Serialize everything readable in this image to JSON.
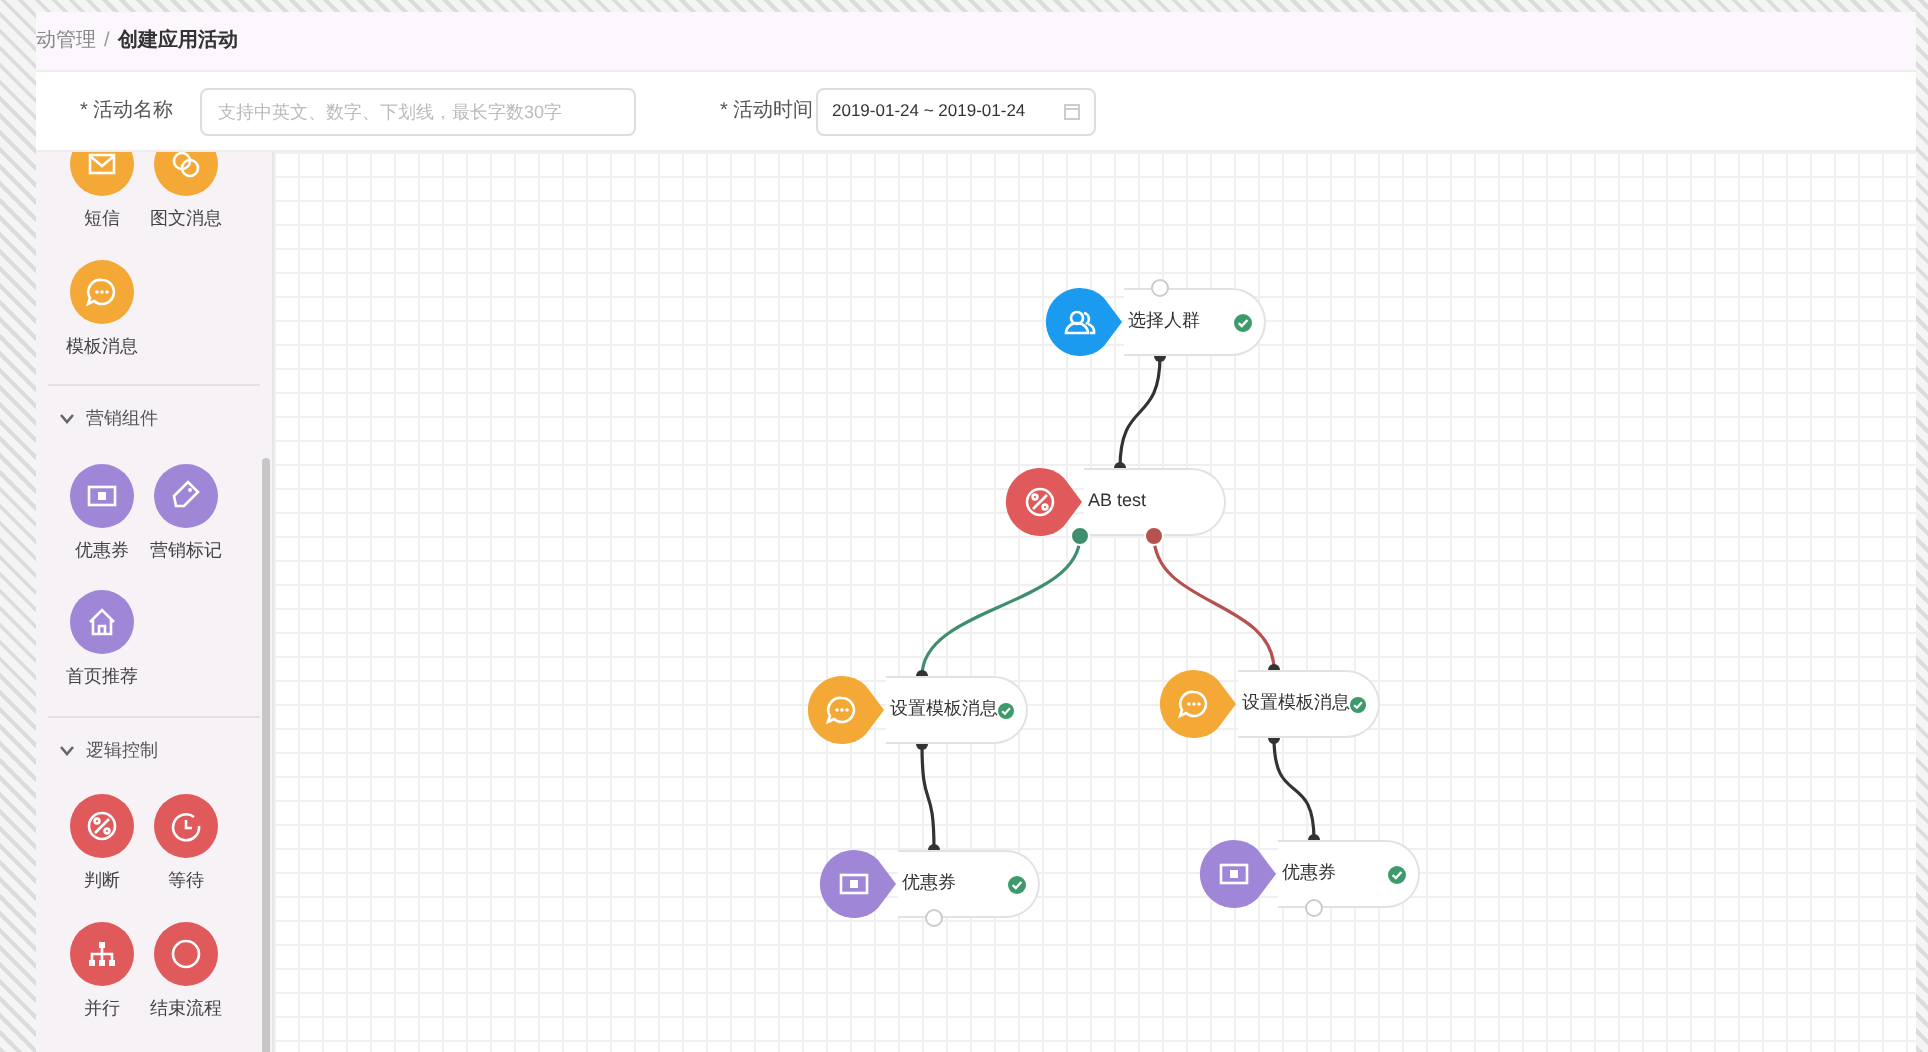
{
  "breadcrumb": {
    "items": [
      "动管理",
      "创建应用活动"
    ],
    "separator": "/"
  },
  "form": {
    "fields": [
      {
        "kind": "text",
        "label": "* 活动名称",
        "placeholder": "支持中英文、数字、下划线，最长字数30字"
      },
      {
        "kind": "date",
        "label": "* 活动时间",
        "value": "2019-01-24 ~ 2019-01-24"
      }
    ]
  },
  "palette": {
    "groups": [
      {
        "color": "#f4a836",
        "items": [
          {
            "label": "短信",
            "kind": "sms"
          },
          {
            "label": "图文消息",
            "kind": "news"
          },
          {
            "label": "模板消息",
            "kind": "message"
          }
        ]
      },
      {
        "title": "营销组件",
        "expanded": true,
        "color": "#9f86d6",
        "items": [
          {
            "label": "优惠券",
            "kind": "coupon"
          },
          {
            "label": "营销标记",
            "kind": "tag"
          },
          {
            "label": "首页推荐",
            "kind": "home"
          }
        ]
      },
      {
        "title": "逻辑控制",
        "expanded": true,
        "color": "#e0595b",
        "items": [
          {
            "label": "判断",
            "kind": "split"
          },
          {
            "label": "等待",
            "kind": "wait"
          },
          {
            "label": "并行",
            "kind": "parallel"
          },
          {
            "label": "结束流程",
            "kind": "end"
          }
        ]
      }
    ]
  },
  "flow": {
    "root": {
      "label": "选择人群",
      "kind": "audience",
      "color": "#1a9bf0",
      "verified": true,
      "children": [
        {
          "label": "AB test",
          "kind": "split",
          "color": "#e0595b",
          "verified": false,
          "children": [
            {
              "label": "设置模板消息",
              "kind": "message",
              "color": "#f4a836",
              "verified": true,
              "edge": {
                "color": "#3f8f6f"
              },
              "children": [
                {
                  "label": "优惠券",
                  "kind": "coupon",
                  "color": "#9f86d6",
                  "verified": true
                }
              ]
            },
            {
              "label": "设置模板消息",
              "kind": "message",
              "color": "#f4a836",
              "verified": true,
              "edge": {
                "color": "#b5514e"
              },
              "children": [
                {
                  "label": "优惠券",
                  "kind": "coupon",
                  "color": "#9f86d6",
                  "verified": true
                }
              ]
            }
          ]
        }
      ]
    }
  }
}
